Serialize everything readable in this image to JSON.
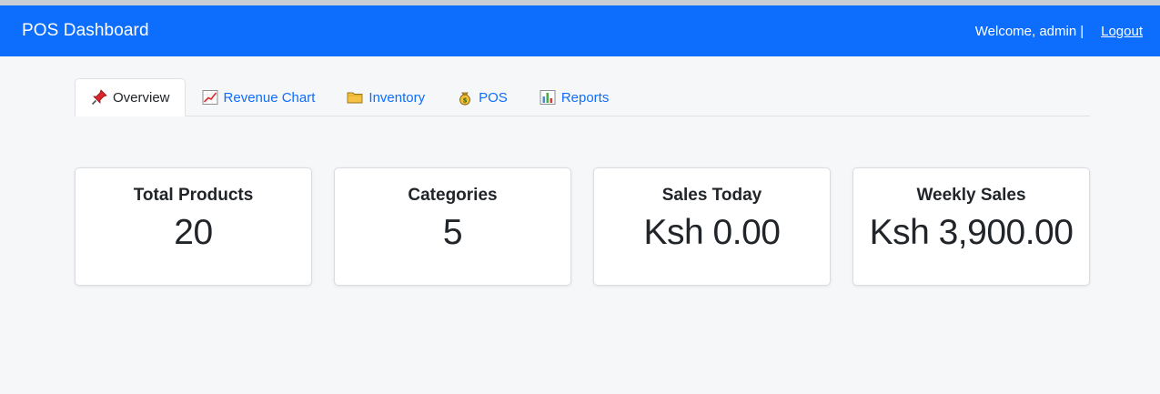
{
  "navbar": {
    "brand": "POS Dashboard",
    "welcome": "Welcome, admin",
    "separator": "|",
    "logout": "Logout",
    "color": "#0d6efd"
  },
  "tabs": [
    {
      "label": "Overview",
      "icon": "pushpin-icon",
      "active": true
    },
    {
      "label": "Revenue Chart",
      "icon": "chart-increasing-icon",
      "active": false
    },
    {
      "label": "Inventory",
      "icon": "folder-icon",
      "active": false
    },
    {
      "label": "POS",
      "icon": "money-bag-icon",
      "active": false
    },
    {
      "label": "Reports",
      "icon": "bar-chart-icon",
      "active": false
    }
  ],
  "stats": [
    {
      "title": "Total Products",
      "value": "20"
    },
    {
      "title": "Categories",
      "value": "5"
    },
    {
      "title": "Sales Today",
      "value": "Ksh 0.00"
    },
    {
      "title": "Weekly Sales",
      "value": "Ksh 3,900.00"
    }
  ]
}
